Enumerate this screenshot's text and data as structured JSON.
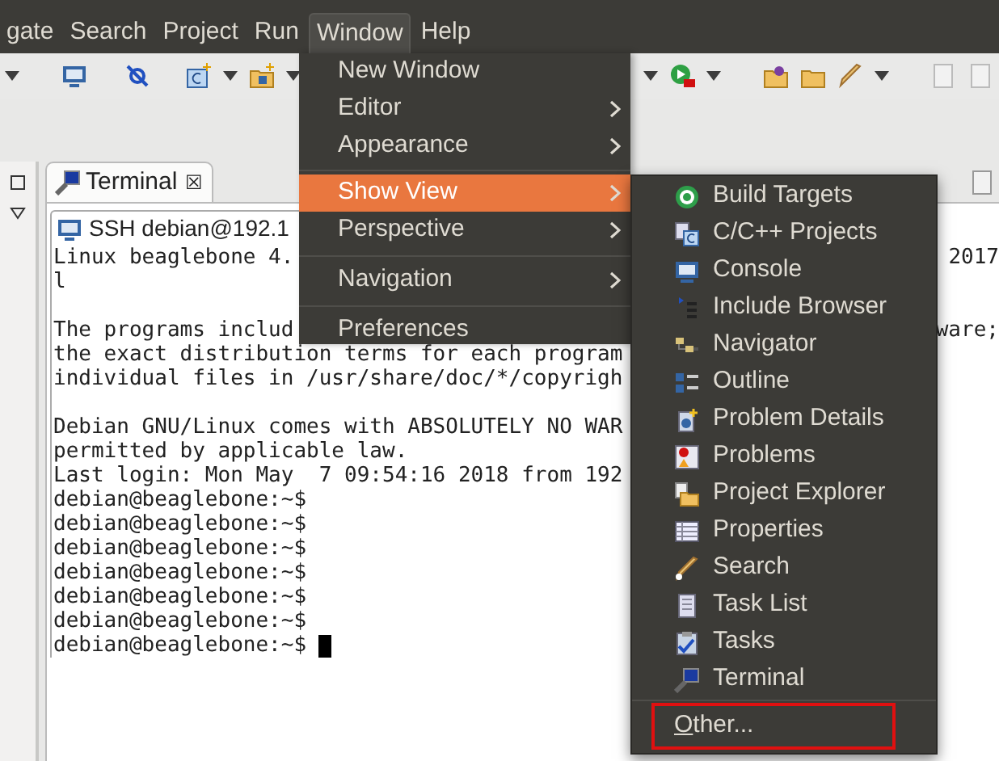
{
  "menubar": [
    {
      "label": "gate",
      "selected": false
    },
    {
      "label": "Search",
      "selected": false
    },
    {
      "label": "Project",
      "selected": false
    },
    {
      "label": "Run",
      "selected": false
    },
    {
      "label": "Window",
      "selected": true
    },
    {
      "label": "Help",
      "selected": false
    }
  ],
  "window_menu": {
    "groups": [
      [
        {
          "label": "New Window",
          "submenu": false,
          "selected": false
        },
        {
          "label": "Editor",
          "submenu": true,
          "selected": false
        },
        {
          "label": "Appearance",
          "submenu": true,
          "selected": false
        }
      ],
      [
        {
          "label": "Show View",
          "submenu": true,
          "selected": true
        },
        {
          "label": "Perspective",
          "submenu": true,
          "selected": false
        }
      ],
      [
        {
          "label": "Navigation",
          "submenu": true,
          "selected": false
        }
      ],
      [
        {
          "label": "Preferences",
          "submenu": false,
          "selected": false
        }
      ]
    ]
  },
  "show_view_menu": {
    "items": [
      "Build Targets",
      "C/C++ Projects",
      "Console",
      "Include Browser",
      "Navigator",
      "Outline",
      "Problem Details",
      "Problems",
      "Project Explorer",
      "Properties",
      "Search",
      "Task List",
      "Tasks",
      "Terminal"
    ],
    "other": {
      "label": "Other...",
      "outlined": true
    }
  },
  "terminal_tab": {
    "label": "Terminal",
    "close": "☒"
  },
  "terminal": {
    "connection": "SSH debian@192.1",
    "paragraphs": [
      [
        {
          "text": "Linux beaglebone 4.",
          "tail": "2017"
        },
        {
          "text": "l"
        }
      ],
      [
        {
          "text": "The programs includ",
          "tail": "ware;"
        },
        {
          "text": "the exact distribution terms for each program"
        },
        {
          "text": "individual files in /usr/share/doc/*/copyrigh"
        }
      ],
      [
        {
          "text": "Debian GNU/Linux comes with ABSOLUTELY NO WAR"
        },
        {
          "text": "permitted by applicable law."
        },
        {
          "text": "Last login: Mon May  7 09:54:16 2018 from 192"
        },
        {
          "text": "debian@beaglebone:~$"
        },
        {
          "text": "debian@beaglebone:~$"
        },
        {
          "text": "debian@beaglebone:~$"
        },
        {
          "text": "debian@beaglebone:~$"
        },
        {
          "text": "debian@beaglebone:~$"
        },
        {
          "text": "debian@beaglebone:~$"
        },
        {
          "text": "debian@beaglebone:~$ "
        }
      ]
    ],
    "cursor": true
  }
}
